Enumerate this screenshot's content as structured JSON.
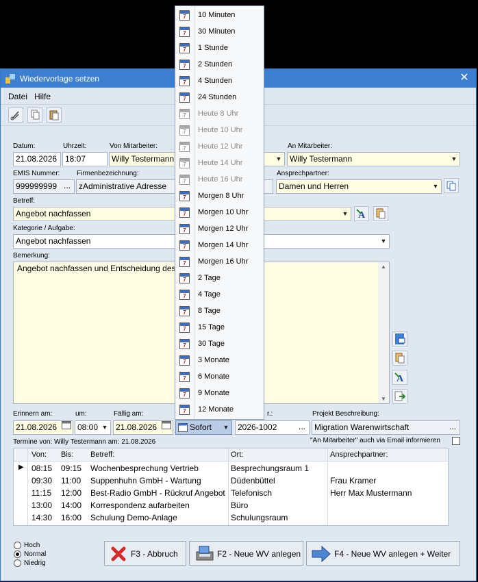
{
  "window": {
    "title": "Wiedervorlage setzen",
    "close": "✕"
  },
  "menu": {
    "file": "Datei",
    "help": "Hilfe"
  },
  "labels": {
    "date": "Datum:",
    "time": "Uhrzeit:",
    "from": "Von Mitarbeiter:",
    "to": "An Mitarbeiter:",
    "emis": "EMIS Nummer:",
    "company": "Firmenbezeichnung:",
    "contact": "Ansprechpartner:",
    "subject": "Betreff:",
    "category": "Kategorie / Aufgabe:",
    "remark": "Bemerkung:",
    "remind": "Erinnern am:",
    "at": "um:",
    "due": "Fällig am:",
    "projnr": "r.:",
    "projdesc": "Projekt Beschreibung:",
    "termine": "Termine von: Willy Testermann am: 21.08.2026",
    "emailnote": "\"An Mitarbeiter\" auch via Email informieren"
  },
  "fields": {
    "date": "21.08.2026",
    "time": "18:07",
    "from": "Willy Testermann",
    "to": "Willy Testermann",
    "emis": "999999999",
    "company": "zAdministrative Adresse",
    "contact": "Damen und Herren",
    "subject": "Angebot nachfassen",
    "category": "Angebot nachfassen",
    "remark": "Angebot nachfassen und Entscheidung des",
    "remind_date": "21.08.2026",
    "remind_time": "08:00",
    "due_date": "21.08.2026",
    "due_option": "Sofort",
    "projnr": "2026-1002",
    "projdesc": "Migration Warenwirtschaft",
    "dots": "..."
  },
  "grid": {
    "headers": [
      "Von:",
      "Bis:",
      "Betreff:",
      "Ort:",
      "Ansprechpartner:"
    ],
    "rows": [
      {
        "von": "08:15",
        "bis": "09:15",
        "betreff": "Wochenbesprechung Vertrieb",
        "ort": "Besprechungsraum 1",
        "ap": ""
      },
      {
        "von": "09:30",
        "bis": "11:00",
        "betreff": "Suppenhuhn GmbH - Wartung",
        "ort": "Düdenbüttel",
        "ap": "Frau Kramer"
      },
      {
        "von": "11:15",
        "bis": "12:00",
        "betreff": "Best-Radio GmbH - Rückruf Angebot",
        "ort": "Telefonisch",
        "ap": "Herr Max Mustermann"
      },
      {
        "von": "13:00",
        "bis": "14:00",
        "betreff": "Korrespondenz aufarbeiten",
        "ort": "Büro",
        "ap": ""
      },
      {
        "von": "14:30",
        "bis": "16:00",
        "betreff": "Schulung Demo-Anlage",
        "ort": "Schulungsraum",
        "ap": ""
      }
    ]
  },
  "priority": {
    "high": "Hoch",
    "normal": "Normal",
    "low": "Niedrig"
  },
  "buttons": {
    "cancel": "F3 - Abbruch",
    "new": "F2 - Neue WV anlegen",
    "next": "F4 - Neue WV anlegen + Weiter"
  },
  "popup": {
    "icon_text": "7",
    "items": [
      {
        "label": "10 Minuten",
        "enabled": true
      },
      {
        "label": "30 Minuten",
        "enabled": true
      },
      {
        "label": "1 Stunde",
        "enabled": true
      },
      {
        "label": "2 Stunden",
        "enabled": true
      },
      {
        "label": "4 Stunden",
        "enabled": true
      },
      {
        "label": "24 Stunden",
        "enabled": true
      },
      {
        "label": "Heute 8 Uhr",
        "enabled": false
      },
      {
        "label": "Heute 10 Uhr",
        "enabled": false
      },
      {
        "label": "Heute 12 Uhr",
        "enabled": false
      },
      {
        "label": "Heute 14 Uhr",
        "enabled": false
      },
      {
        "label": "Heute 16 Uhr",
        "enabled": false
      },
      {
        "label": "Morgen 8 Uhr",
        "enabled": true
      },
      {
        "label": "Morgen 10 Uhr",
        "enabled": true
      },
      {
        "label": "Morgen 12 Uhr",
        "enabled": true
      },
      {
        "label": "Morgen 14 Uhr",
        "enabled": true
      },
      {
        "label": "Morgen 16 Uhr",
        "enabled": true
      },
      {
        "label": "2 Tage",
        "enabled": true
      },
      {
        "label": "4 Tage",
        "enabled": true
      },
      {
        "label": "8 Tage",
        "enabled": true
      },
      {
        "label": "15 Tage",
        "enabled": true
      },
      {
        "label": "30 Tage",
        "enabled": true
      },
      {
        "label": "3 Monate",
        "enabled": true
      },
      {
        "label": "6 Monate",
        "enabled": true
      },
      {
        "label": "9 Monate",
        "enabled": true
      },
      {
        "label": "12 Monate",
        "enabled": true
      }
    ]
  }
}
